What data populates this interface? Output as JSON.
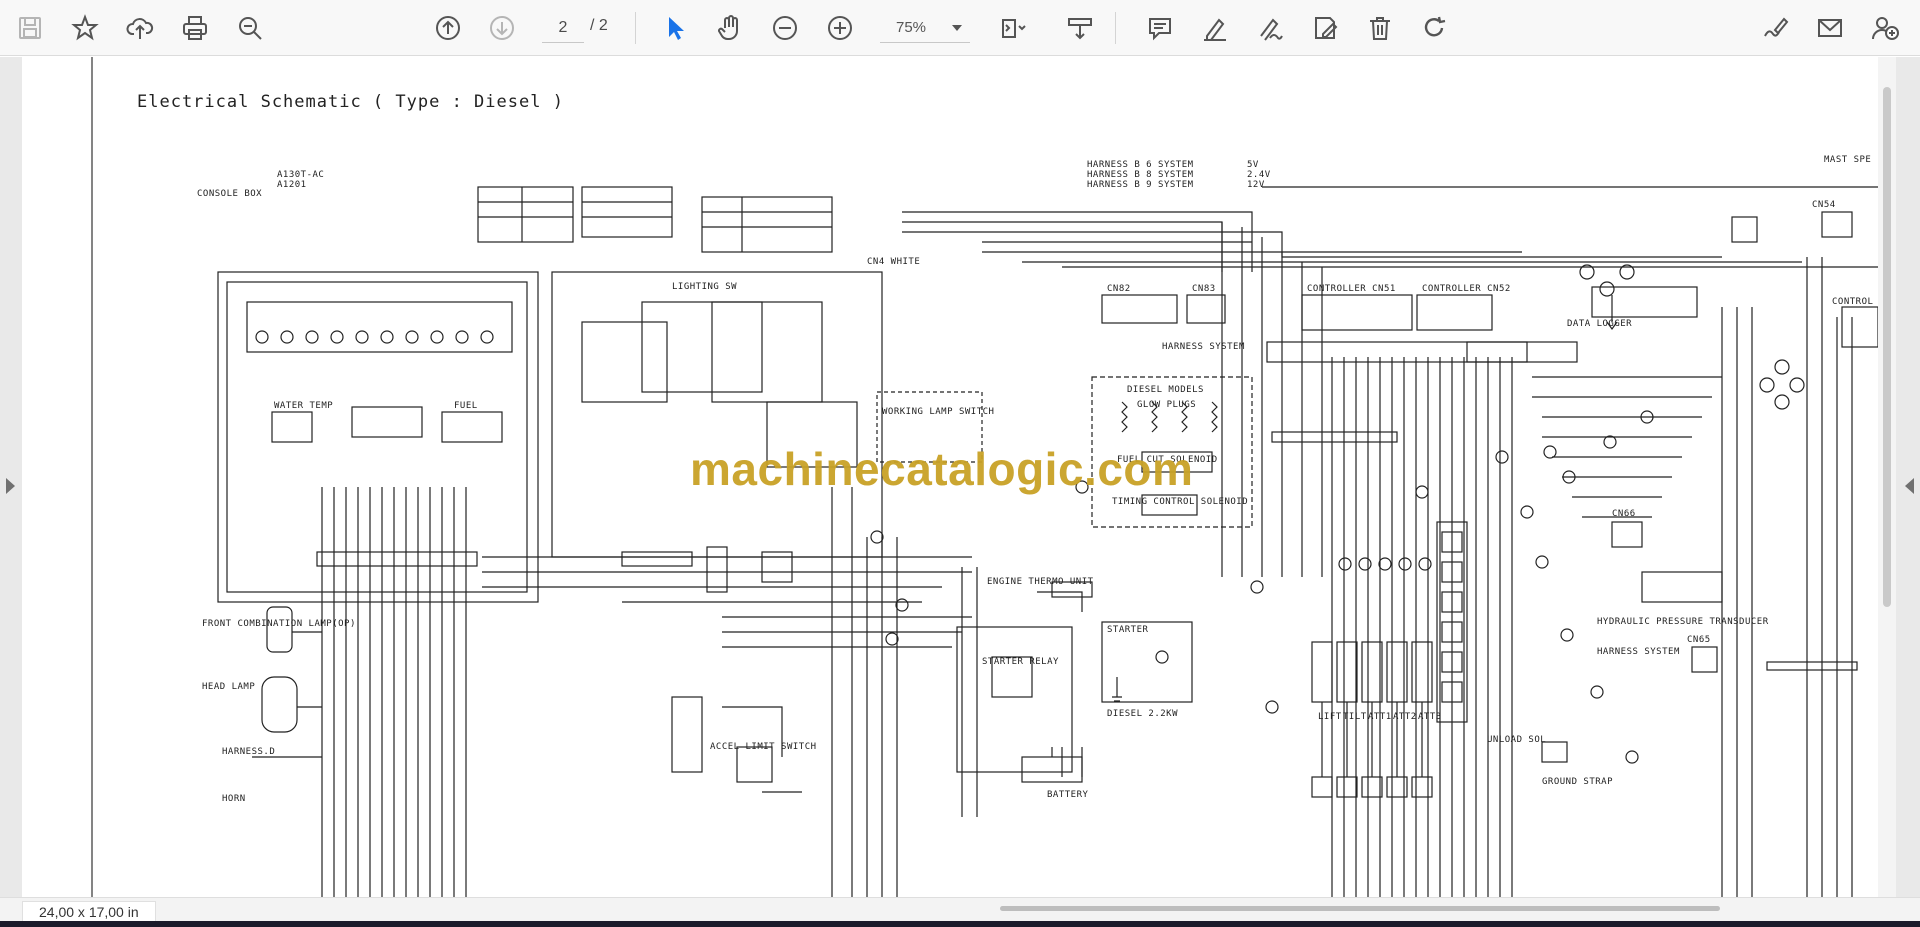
{
  "toolbar": {
    "page_current": "2",
    "page_total": "/ 2",
    "zoom_value": "75%"
  },
  "status": {
    "page_size": "24,00 x 17,00 in"
  },
  "watermark": "machinecatalogic.com",
  "schematic": {
    "title": "Electrical Schematic ( Type : Diesel )",
    "labels": {
      "console_box": "CONSOLE BOX",
      "a130t": "A130T-AC",
      "a1201": "A1201",
      "cn4_white": "CN4 WHITE",
      "lighting_sw": "LIGHTING SW",
      "cn82": "CN82",
      "cn83": "CN83",
      "controller_cn51": "CONTROLLER CN51",
      "controller_cn52": "CONTROLLER CN52",
      "data_logger": "DATA LOGGER",
      "harness_system_1": "HARNESS SYSTEM",
      "diesel_models": "DIESEL MODELS",
      "glow_plugs": "GLOW PLUGS",
      "fuel_cut_solenoid": "FUEL CUT SOLENOID",
      "timing_control_solenoid": "TIMING CONTROL SOLENOID",
      "working_lamp_switch": "WORKING LAMP SWITCH",
      "engine_thermo_unit": "ENGINE THERMO UNIT",
      "starter": "STARTER",
      "starter_relay": "STARTER RELAY",
      "diesel_22kw": "DIESEL 2.2KW",
      "battery": "BATTERY",
      "front_combination_lamp": "FRONT COMBINATION LAMP(OP)",
      "head_lamp": "HEAD LAMP",
      "harness_d": "HARNESS.D",
      "horn": "HORN",
      "accel_limit_switch": "ACCEL LIMIT SWITCH",
      "unload_sol": "UNLOAD SOL",
      "hydraulic_pressure_transducer": "HYDRAULIC PRESSURE TRANSDUCER",
      "harness_system_2": "HARNESS SYSTEM",
      "cn65": "CN65",
      "cn66": "CN66",
      "cn54": "CN54",
      "mast_spec": "MAST SPE",
      "control_short": "CONTROL",
      "water_temp": "WATER TEMP",
      "fuel": "FUEL",
      "ground_strap": "GROUND STRAP",
      "lift": "LIFT",
      "tilt": "TILT",
      "att1": "ATT1",
      "att2": "ATT2",
      "att3": "ATT3",
      "harness_b6": "HARNESS B 6 SYSTEM",
      "harness_b8": "HARNESS B 8 SYSTEM",
      "harness_b9": "HARNESS B 9 SYSTEM",
      "v5": "5V",
      "v24": "2.4V",
      "v12": "12V"
    }
  }
}
